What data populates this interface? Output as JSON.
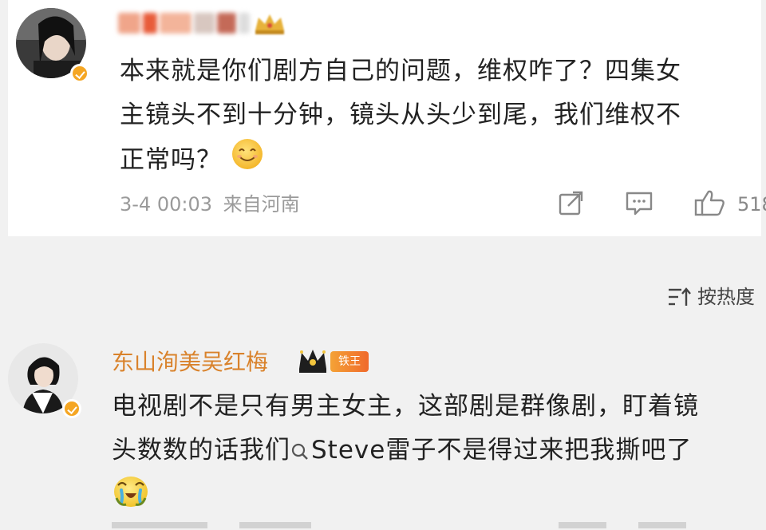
{
  "comment1": {
    "text_line1": "本来就是你们剧方自己的问题，维权咋了？四集女",
    "text_line2": "主镜头不到十分钟，镜头从头少到尾，我们维权不",
    "text_line3": "正常吗？",
    "emoji": "smile-icon",
    "timestamp": "3-4 00:03",
    "location": "来自河南",
    "like_count": "518",
    "icons": [
      "share-icon",
      "comment-icon",
      "like-icon"
    ]
  },
  "sort": {
    "label": "按热度",
    "icon": "sort-icon"
  },
  "comment2": {
    "username": "东山洵美吴红梅",
    "fan_badge": "铁王",
    "text_line1": "电视剧不是只有男主女主，这部剧是群像剧，盯着镜",
    "text_line2_before": "头数数的话我们",
    "mention": "Steve雷子",
    "text_line2_after": "不是得过来把我撕吧了",
    "emoji": "laughing-cry-icon"
  },
  "colors": {
    "username_orange": "#d9822b",
    "verify_yellow": "#f5a623",
    "text_dark": "#222222",
    "meta_grey": "#9a9a9a"
  }
}
